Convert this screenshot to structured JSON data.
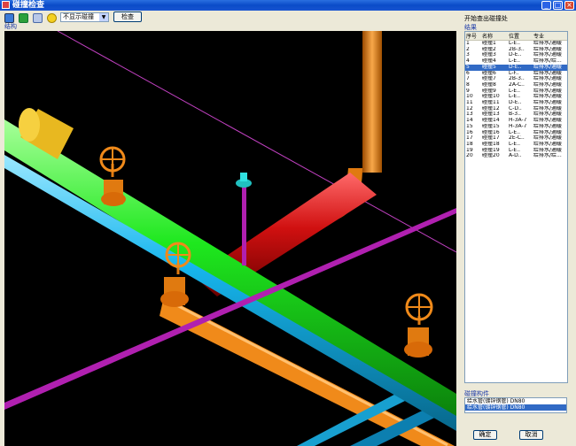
{
  "window": {
    "title": "碰撞检查",
    "min": "_",
    "max": "□",
    "close": "×"
  },
  "toolbar": {
    "combo_value": "不显示碰撞",
    "check_label": "检查",
    "view_tag": "结构"
  },
  "panel": {
    "title": "开始查出碰撞处",
    "result_label": "结果",
    "headers": [
      "序号",
      "名称",
      "位置",
      "专业"
    ],
    "rows": [
      [
        "1",
        "碰撞1",
        "L-E..",
        "给排水/通暖"
      ],
      [
        "2",
        "碰撞2",
        "2B-3..",
        "给排水/通暖"
      ],
      [
        "3",
        "碰撞3",
        "D-E..",
        "给排水/通暖"
      ],
      [
        "4",
        "碰撞4",
        "L-E..",
        "给排水/给..."
      ],
      [
        "5",
        "碰撞5",
        "D-E..",
        "给排水/通暖"
      ],
      [
        "6",
        "碰撞6",
        "L-F..",
        "给排水/通暖"
      ],
      [
        "7",
        "碰撞7",
        "2B-3..",
        "给排水/通暖"
      ],
      [
        "8",
        "碰撞8",
        "2A-C..",
        "给排水/通暖"
      ],
      [
        "9",
        "碰撞9",
        "L-E..",
        "给排水/通暖"
      ],
      [
        "10",
        "碰撞10",
        "L-E..",
        "给排水/通暖"
      ],
      [
        "11",
        "碰撞11",
        "D-E..",
        "给排水/通暖"
      ],
      [
        "12",
        "碰撞12",
        "C-D..",
        "给排水/通暖"
      ],
      [
        "13",
        "碰撞13",
        "B-3..",
        "给排水/通暖"
      ],
      [
        "14",
        "碰撞14",
        "H-3A-7",
        "给排水/通暖"
      ],
      [
        "15",
        "碰撞15",
        "H-3A-7",
        "给排水/通暖"
      ],
      [
        "16",
        "碰撞16",
        "L-E..",
        "给排水/通暖"
      ],
      [
        "17",
        "碰撞17",
        "2E-C..",
        "给排水/通暖"
      ],
      [
        "18",
        "碰撞18",
        "L-E..",
        "给排水/通暖"
      ],
      [
        "19",
        "碰撞19",
        "L-E..",
        "给排水/通暖"
      ],
      [
        "20",
        "碰撞20",
        "A-D..",
        "给排水/给..."
      ]
    ],
    "selected_row": 4,
    "objects_label": "碰撞构件",
    "objects": [
      "给水管(镀锌钢管) DN80",
      "给水管(镀锌钢管) DN80"
    ],
    "ok_label": "确定",
    "cancel_label": "取消"
  },
  "colors": {
    "green_pipe": "#1ee81e",
    "cyan_pipe": "#17b6ee",
    "orange_pipe": "#f08a1a",
    "red_pipe": "#d01010",
    "purple_pipe": "#b020b0"
  }
}
